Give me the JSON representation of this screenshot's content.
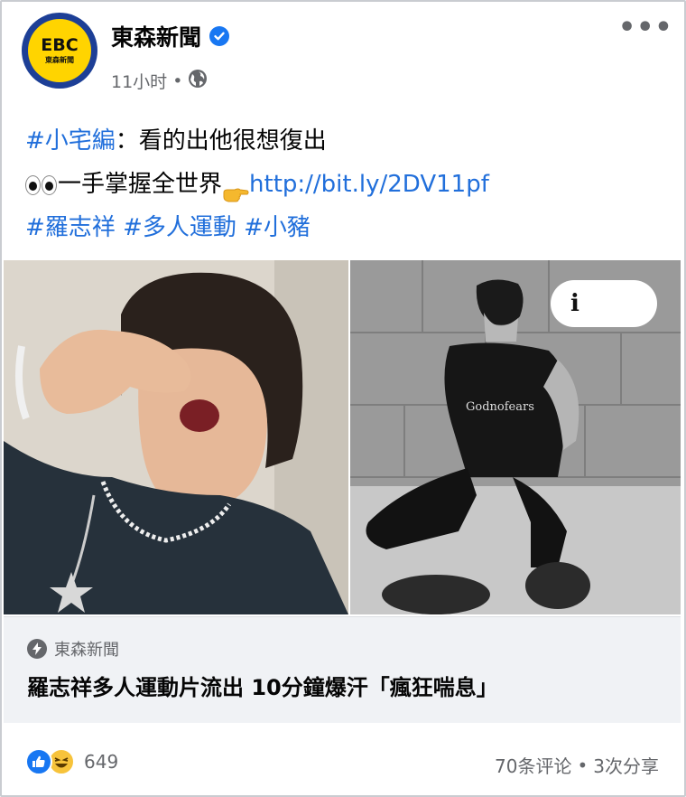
{
  "page": {
    "name": "東森新聞",
    "avatar_logo_text": "EBC",
    "avatar_sub_text": "東森新聞",
    "time": "11小时",
    "dot": "•",
    "more_label": "•••"
  },
  "post": {
    "line1_tag": "#小宅編",
    "line1_text": "：看的出他很想復出",
    "line2_text": "一手掌握全世界",
    "line2_link": "http://bit.ly/2DV11pf",
    "hashtags": [
      "#羅志祥",
      "#多人運動",
      "#小豬"
    ]
  },
  "images": {
    "right_info_label": "i",
    "shirt_text": "Godnofears"
  },
  "preview": {
    "source": "東森新聞",
    "title": "羅志祥多人運動片流出 10分鐘爆汗「瘋狂喘息」"
  },
  "footer": {
    "reaction_count": "649",
    "comments": "70条评论",
    "shares": "3次分享",
    "dot": "•"
  },
  "colors": {
    "link": "#216fdb",
    "secondary_text": "#65676b",
    "verified": "#1877f2",
    "preview_bg": "#f0f2f5"
  }
}
